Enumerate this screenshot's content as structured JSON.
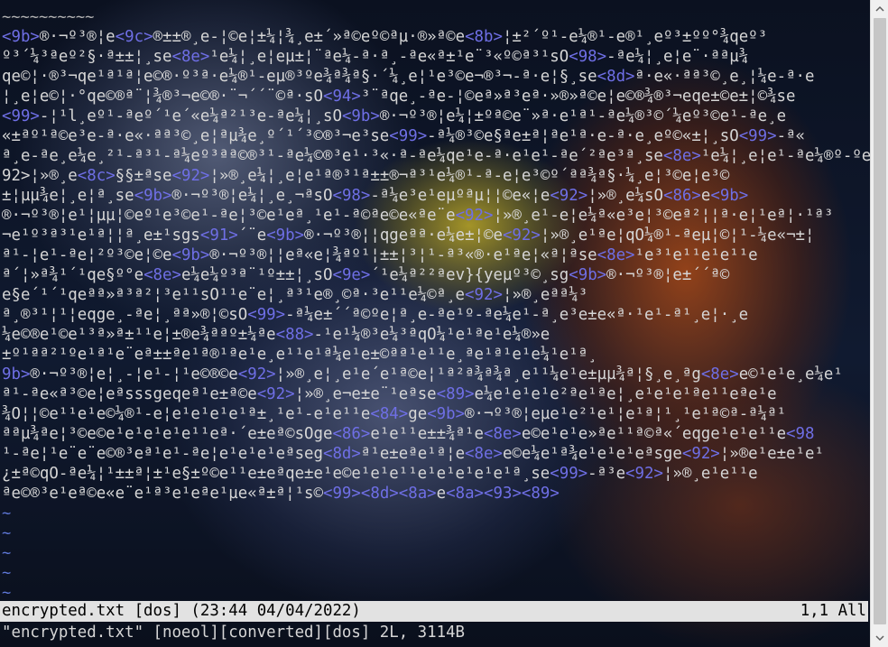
{
  "editor": {
    "top_line": "~~~~~~~~~~",
    "lines": [
      [
        [
          "e",
          "<9b>"
        ],
        [
          "t",
          "®·¬º³®¦e"
        ],
        [
          "e",
          "<9c>"
        ],
        [
          "t",
          "®±±®¸e-¦©e¦±¼¦¾¸e±´»ª©eº©ªµ·®»ª©e"
        ],
        [
          "e",
          "<8b>"
        ],
        [
          "t",
          "¦±²´º¹-e¼®¹-e®¹¸eº³±ºº°¾qeº³"
        ]
      ],
      [
        [
          "t",
          "º³´¼³ªeº²§·ª±±¦¸se"
        ],
        [
          "e",
          "<8e>"
        ],
        [
          "t",
          "¹e¼¦¸e¦eµ±¦¨ªe¼-ª·ª¸-ªe«ª±¹e¨³«º©ª³¹sO"
        ],
        [
          "e",
          "<98>"
        ],
        [
          "t",
          "-ªe¼¦¸e¦e¨·ªªµ¾"
        ]
      ],
      [
        [
          "t",
          "qe©¦·®³¬qe¹ª¹ª¦e©®·º³ª·e¼®¹-eµ®³ºe¾ª¾ª§·´¼¸e¦¹e³©e¬®³¬-ª·e¦§¸se"
        ],
        [
          "e",
          "<8d>"
        ],
        [
          "t",
          "ª·e«·ªª³©¸e¸¦¼e-ª·e"
        ]
      ],
      [
        [
          "t",
          "¦¸e¦e©¦·°qe©®ª¨¦¾®³¬e©®·¨¬´´¨©ª·sO"
        ],
        [
          "e",
          "<94>"
        ],
        [
          "t",
          "³¨ªqe¸-ªe-¦©eª»ª³eª·»®»ª©e¦e©®¾®³¬eqe±©e±¦©¾se"
        ]
      ],
      [
        [
          "e",
          "<99>"
        ],
        [
          "t",
          "-¦¹l¸eº¹-ªeº´¹e´«e¼ª²¹³e-ªe¼¦¸sO"
        ],
        [
          "e",
          "<9b>"
        ],
        [
          "t",
          "®·¬º³®¦e¼¦±ºª©e¨»ª·e¹ª¹-ªe¼®³©´¼eº³©e¹-ªe¸e"
        ]
      ],
      [
        [
          "t",
          "«±ªº¹ª©e³e-ª·e«·ªª³©¸e¦ªµ¾e¸º´¹´³©®³¬e³se"
        ],
        [
          "e",
          "<99>"
        ],
        [
          "t",
          "-ª¼®³©e§ªe±ª¦ªe¹ª·e-ª·e¸eº©«±¦¸sO"
        ],
        [
          "e",
          "<99>"
        ],
        [
          "t",
          "-ª«"
        ]
      ],
      [
        [
          "t",
          "ª¸e-ªe¸e¼e¸²¹-ª³¹-ª¼eº³ªª©®³¹-ªe¼©®³e¹·³«·ª-ªe¼qe¹e-ª·e¹e¹-ªe´²ªe³ª¸se"
        ],
        [
          "e",
          "<8e>"
        ],
        [
          "t",
          "¹e¼¦¸e¦e¹-ªe¼®º-ºe¹ªe"
        ],
        [
          "e",
          "<"
        ]
      ],
      [
        [
          "t",
          "92>"
        ],
        [
          "t",
          "¦»®¸e"
        ],
        [
          "e",
          "<8c>"
        ],
        [
          "t",
          "§§±ªse"
        ],
        [
          "e",
          "<92>"
        ],
        [
          "t",
          "¦»®¸e¼¦¸e¦e¹ª®³¹ª±±®¬ª³¹e¼®¹-ª-e¦e³©º´ªª¾ª§·¼¸e¦³©e¦e³©"
        ]
      ],
      [
        [
          "t",
          "±¦µµ¾e¦¸e¦ª¸se"
        ],
        [
          "e",
          "<9b>"
        ],
        [
          "t",
          "®·¬º³®¦e¼¦¸e¸¬ªsO"
        ],
        [
          "e",
          "<98>"
        ],
        [
          "t",
          "-ª¼e³e¹eµºªµ¦¦©e«¦e"
        ],
        [
          "e",
          "<92>"
        ],
        [
          "t",
          "¦»®¸e¼sO"
        ],
        [
          "e",
          "<86>"
        ],
        [
          "t",
          "e"
        ],
        [
          "e",
          "<9b>"
        ]
      ],
      [
        [
          "t",
          "®·¬º³®¦e¹¦µµ¦©eº¹e³©e¹-ªe¦³©e¹eª¸¹e¹-ª©ªe©e«ªe¨e"
        ],
        [
          "e",
          "<92>"
        ],
        [
          "t",
          "¦»®¸e¹-e¦e¼ª«e³e¦³©eª²¦¦ª·e¦¹eª¦·¹ª³"
        ]
      ],
      [
        [
          "t",
          "¬e¹º³ª³¹e¹ª¦¦ª¸e±¹sgs"
        ],
        [
          "e",
          "<91>"
        ],
        [
          "t",
          "´¨e"
        ],
        [
          "e",
          "<9b>"
        ],
        [
          "t",
          "®·¬º³®¦¦qgeªª·e¼e±¦©e"
        ],
        [
          "e",
          "<92>"
        ],
        [
          "t",
          "¦»®¸e¹ªe¦qO¼®¹-ªeµ¦©¦¹-¼e«¬±¦"
        ]
      ],
      [
        [
          "t",
          "ª¹-¦e¹-ªe¦²º³©e¦©e"
        ],
        [
          "e",
          "<9b>"
        ],
        [
          "t",
          "®·¬º³®¦¦eª«e¦¾ªº¹¦±±¦³¦¹-ª³«®·e¹ªe¦«ª¦ªse"
        ],
        [
          "e",
          "<8e>"
        ],
        [
          "t",
          "¹e³¹e¹¹e¹e¹¹e"
        ]
      ],
      [
        [
          "t",
          "ª´¦»ª¾¹´¹qe§º°e"
        ],
        [
          "e",
          "<8e>"
        ],
        [
          "t",
          "e¼e¼º³ª¨¹º±±¦¸sO"
        ],
        [
          "e",
          "<9e>"
        ],
        [
          "t",
          "´¹e¼ª²²ªev}{yeµº³©¸sg"
        ],
        [
          "e",
          "<9b>"
        ],
        [
          "t",
          "®·¬º³®¦e±´´ª©"
        ]
      ],
      [
        [
          "t",
          "e§e´¹´¹qeªª»ª³ª²¦³e¹¹sO¹¹e¨e¦¸ª³¹e®¸©ª·³e¹¹e¼©ª¸e"
        ],
        [
          "e",
          "<92>"
        ],
        [
          "t",
          "¦»®¸eªª¼³"
        ]
      ],
      [
        [
          "t",
          "ª¸®³¹¦¹¦eqge¸-ªe¦¸ªª»®¦©sO"
        ],
        [
          "e",
          "<99>"
        ],
        [
          "t",
          "-ª¼e±´´ª©ºe¦ª¸e-ªe¹º-ªe¼e¹-ª¸e³e±e«ª·¹e¹-ª¹¸e¦·¸e"
        ]
      ],
      [
        [
          "t",
          "¼e©®e¹©e¹³ª»ª±¹¹e¦±®e¾ªªº±¼ªe"
        ],
        [
          "e",
          "<88>"
        ],
        [
          "t",
          "-¹e¹¼®³e¼³ªqO¼¹e¹ªe¹e¼®»e"
        ]
      ],
      [
        [
          "t",
          "±º¹ªª²¹ºe¹ª¹e¨eª±±ªe¹ª®¹ªe¹e¸e¹¹e¹ª¼e¹e±©ªª¹e¹¹e¸ªe¹ª¹e¹e¼¹e¹ª¸"
        ]
      ],
      [
        [
          "e",
          "9b>"
        ],
        [
          "t",
          "®·¬º³®¦e¦¸-¦e¹-¦¹e©®©e"
        ],
        [
          "e",
          "<92>"
        ],
        [
          "t",
          "¦»®¸e¦¸e¹e´e¹ª©e¦¹ª²ª¾ª¾ª¸e¹¹¼e¹e±µµ¾ª¦§¸e¸ªg"
        ],
        [
          "e",
          "<8e>"
        ],
        [
          "t",
          "e©¹e¹e¸e¼e¹"
        ]
      ],
      [
        [
          "t",
          "ª¹-ªe«ª³©e¦eªsssgeqeª¹e±ª©e"
        ],
        [
          "e",
          "<92>"
        ],
        [
          "t",
          "¦»®¸e¬e±e¨¹eªse"
        ],
        [
          "e",
          "<89>"
        ],
        [
          "t",
          "e¼e¹e¹e¹e²ªe¹ªe¦¸e¹e¹e¹ªe¹¹eªe¹e"
        ]
      ],
      [
        [
          "t",
          "¾O¦¦©e¹¹e¹e©¼®¹-e¦e¹e¹e¹e¹ª±¸¹e¹-e¹e¹¹e"
        ],
        [
          "e",
          "<84>"
        ],
        [
          "t",
          "ge"
        ],
        [
          "e",
          "<9b>"
        ],
        [
          "t",
          "®·¬º³®¦eµe¹e²¹e¹¦e¹ª¦¹¸¹e¹ª©ª-ª¼ª¹"
        ]
      ],
      [
        [
          "t",
          "ªªµ¾ªe¦³©e©e¹e¹e¹e¹e¹¹eª·´e±eª©sOge"
        ],
        [
          "e",
          "<86>"
        ],
        [
          "t",
          "e¹e¹¹e±±¾ª¹e"
        ],
        [
          "e",
          "<8e>"
        ],
        [
          "t",
          "e©e¹e¹e»ªe¹¹ª©ª«´eqge¹e¹e¹¹e"
        ],
        [
          "e",
          "<98"
        ]
      ],
      [
        [
          "t",
          "¹-ªe¦¹e¨e¨e©®³eª¹e¹-ªe¦e¹e¹e¹eªseg"
        ],
        [
          "e",
          "<8d>"
        ],
        [
          "t",
          "ª¹e±eªe¹ª¦e"
        ],
        [
          "e",
          "<8e>"
        ],
        [
          "t",
          "e©e¼e¹ª¾e¹e¹e¹eªsge"
        ],
        [
          "e",
          "<92>"
        ],
        [
          "t",
          "¦»®e¹e±e¹e¹"
        ]
      ],
      [
        [
          "t",
          "¿±ª©qO-ªe¼¦¹±±ª¦±¹e§±º©e¹¹e±eªqe±e¹e©e¹e¹e¹¹e¹e¹e¹e¹e¹ª¸se"
        ],
        [
          "e",
          "<99>"
        ],
        [
          "t",
          "-ª³e"
        ],
        [
          "e",
          "<92>"
        ],
        [
          "t",
          "¦»®¸e¹e¹¹e"
        ]
      ],
      [
        [
          "t",
          "ªe©®³e¹eª©e«e¨e¹ª³e¹eªe¹µe«ª±ª¦¹s©"
        ],
        [
          "e",
          "<99>"
        ],
        [
          "e",
          "<8d>"
        ],
        [
          "e",
          "<8a>"
        ],
        [
          "t",
          "e"
        ],
        [
          "e",
          "<8a>"
        ],
        [
          "e",
          "<93>"
        ],
        [
          "e",
          "<89>"
        ]
      ]
    ],
    "filler_lines": [
      "~",
      "~",
      "~",
      "~",
      "~"
    ],
    "statusline_file": "encrypted.txt [dos] (23:44 04/04/2022)",
    "statusline_pos": "1,1 All",
    "cmdline": "\"encrypted.txt\" [noeol][converted][dos] 2L, 3114B"
  }
}
